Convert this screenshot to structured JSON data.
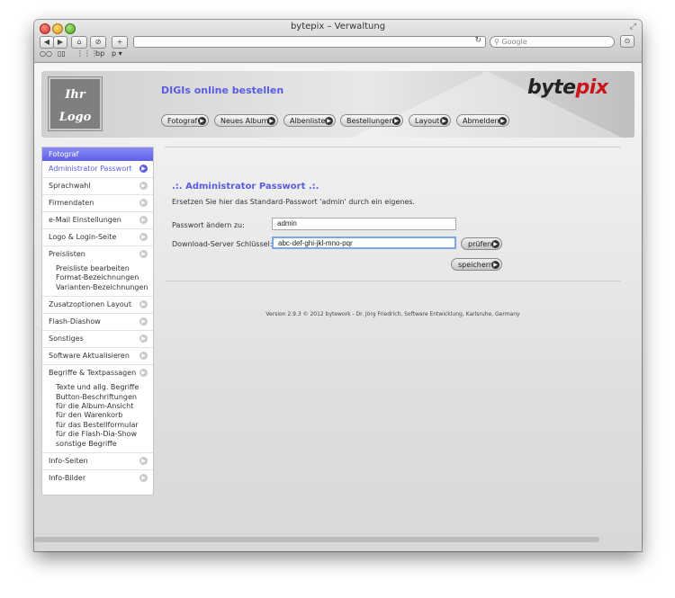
{
  "window": {
    "title": "bytepix – Verwaltung"
  },
  "toolbar": {
    "search_placeholder": "Google",
    "new_tab": "+"
  },
  "bookmarks": {
    "items": [
      "bp",
      "p ▾"
    ]
  },
  "header": {
    "logo_line1": "Ihr",
    "logo_line2": "Logo",
    "shop_title": "DIGIs online bestellen",
    "brand_part1": "byte",
    "brand_part2": "pix",
    "nav": [
      "Fotograf",
      "Neues Album",
      "Albenliste",
      "Bestellungen",
      "Layout",
      "Abmelden"
    ]
  },
  "sidebar": {
    "heading": "Fotograf",
    "items": [
      "Administrator Passwort",
      "Sprachwahl",
      "Firmendaten",
      "e-Mail Einstellungen",
      "Logo & Login-Seite",
      "Preislisten",
      "Zusatzoptionen Layout",
      "Flash-Diashow",
      "Sonstiges",
      "Software Aktualisieren",
      "Begriffe & Textpassagen",
      "Info-Seiten",
      "Info-Bilder"
    ],
    "sub_preislisten": [
      "Preisliste bearbeiten",
      "Format-Bezeichnungen",
      "Varianten-Bezeichnungen"
    ],
    "sub_begriffe": [
      "Texte und allg. Begriffe",
      "Button-Beschriftungen",
      "für die Album-Ansicht",
      "für den Warenkorb",
      "für das Bestellformular",
      "für die Flash-Dia-Show",
      "sonstige Begriffe"
    ]
  },
  "main": {
    "title": ".:. Administrator Passwort .:.",
    "description": "Ersetzen Sie hier das Standard-Passwort 'admin' durch ein eigenes.",
    "password_label": "Passwort ändern zu:",
    "password_value": "admin",
    "key_label": "Download-Server Schlüssel:",
    "key_value": "abc-def-ghi-jkl-mno-pqr",
    "check_button": "prüfen",
    "save_button": "speichern",
    "version": "Version 2.9.3 © 2012 bytework - Dr. Jörg Friedrich, Software Entwicklung, Karlsruhe, Germany"
  },
  "colors": {
    "accent": "#5a5de0",
    "brand_red": "#c8141a"
  }
}
